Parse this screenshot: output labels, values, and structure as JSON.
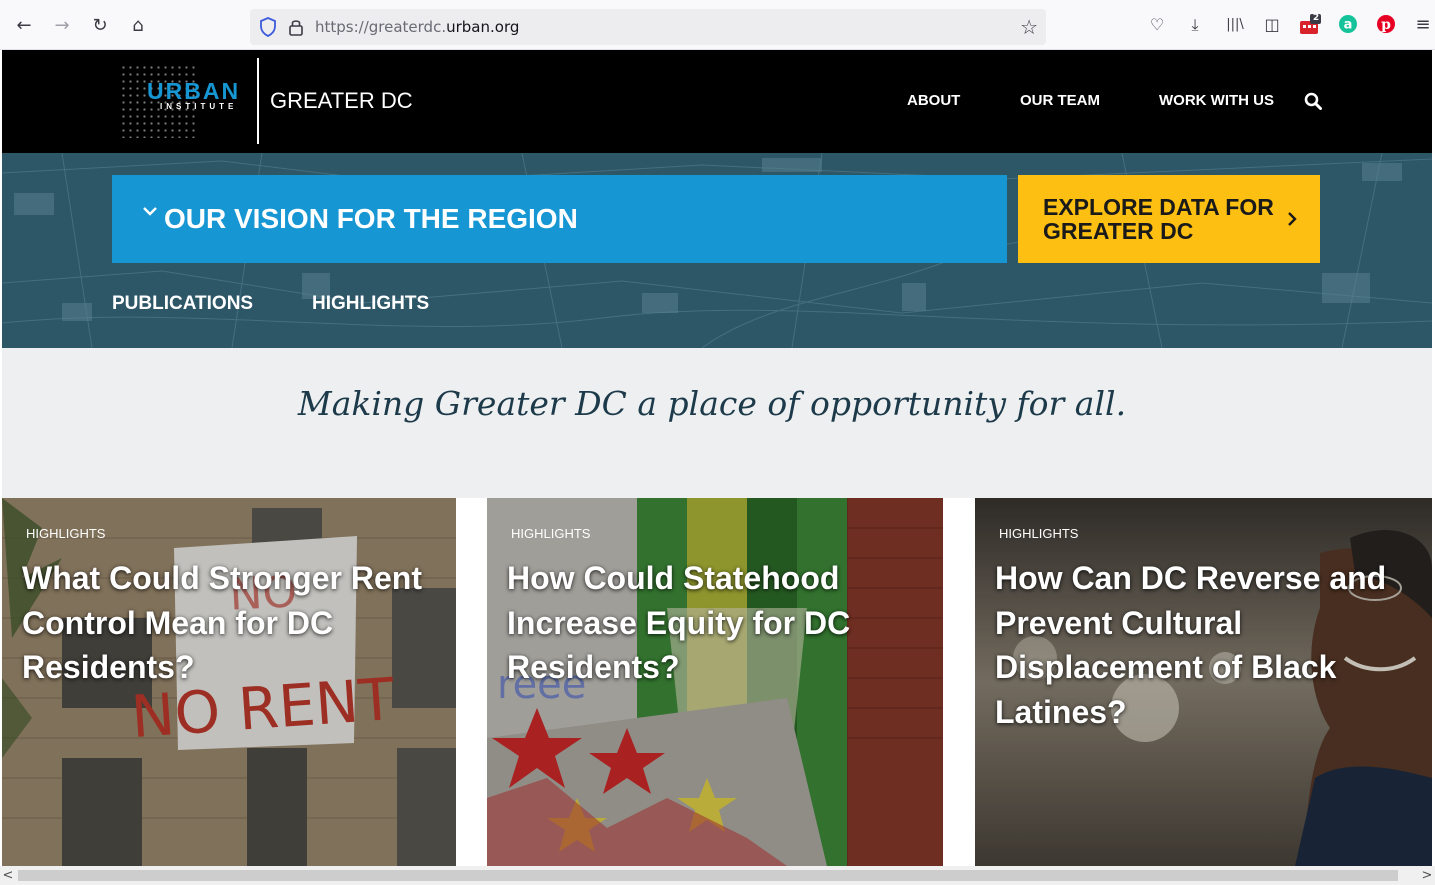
{
  "browser": {
    "url_prefix": "https://greaterdc.",
    "url_domain": "urban.org",
    "back": "←",
    "forward": "→",
    "reload": "↻",
    "home": "⌂",
    "star": "☆",
    "pocket": "♡",
    "download": "⤓",
    "library": "|||\\",
    "sidebar": "◫",
    "extension_badge": "2",
    "menu": "≡",
    "icons": [
      "shield-icon",
      "lock-icon",
      "bookmark-star-icon",
      "pocket-icon",
      "download-icon",
      "library-icon",
      "sidebar-icon",
      "extension-icon",
      "grammarly-icon",
      "pinterest-icon",
      "menu-icon"
    ]
  },
  "header": {
    "logo_word": "URBAN",
    "logo_sub": "INSTITUTE",
    "site_name": "GREATER DC",
    "nav": [
      {
        "label": "ABOUT"
      },
      {
        "label": "OUR TEAM"
      },
      {
        "label": "WORK WITH US"
      }
    ]
  },
  "hero": {
    "vision_label": "OUR VISION FOR THE REGION",
    "explore_label": "EXPLORE DATA FOR GREATER DC",
    "subnav": [
      {
        "label": "PUBLICATIONS"
      },
      {
        "label": "HIGHLIGHTS"
      }
    ]
  },
  "tagline": "Making Greater DC a place of opportunity for all.",
  "cards": [
    {
      "category": "HIGHLIGHTS",
      "title": "What Could Stronger Rent Control Mean for DC Residents?",
      "banner_text": "NO RENT"
    },
    {
      "category": "HIGHLIGHTS",
      "title": "How Could Statehood Increase Equity for DC Residents?"
    },
    {
      "category": "HIGHLIGHTS",
      "title": "How Can DC Reverse and Prevent Cultural Displacement of Black Latines?"
    }
  ],
  "colors": {
    "urban_blue": "#1696d2",
    "urban_yellow": "#fdbf11",
    "header_black": "#000000",
    "hero_teal": "#2d5667"
  },
  "scrollbar": {
    "left": "<",
    "right": ">"
  }
}
